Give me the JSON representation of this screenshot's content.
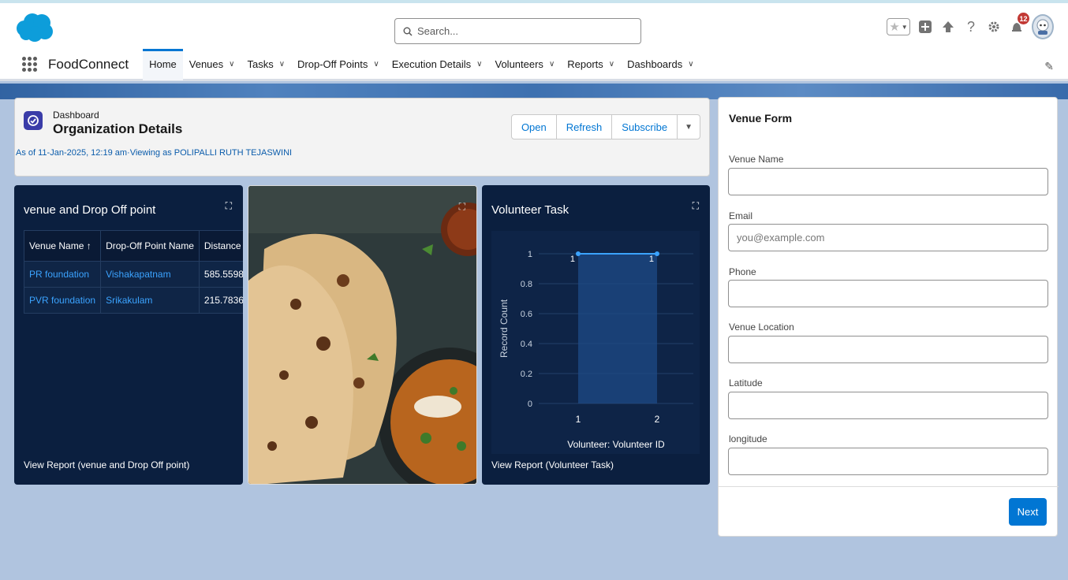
{
  "header": {
    "search_placeholder": "Search...",
    "notification_count": "12"
  },
  "nav": {
    "app_name": "FoodConnect",
    "tabs": [
      {
        "label": "Home",
        "active": true
      },
      {
        "label": "Venues"
      },
      {
        "label": "Tasks"
      },
      {
        "label": "Drop-Off Points"
      },
      {
        "label": "Execution Details"
      },
      {
        "label": "Volunteers"
      },
      {
        "label": "Reports"
      },
      {
        "label": "Dashboards"
      }
    ]
  },
  "dashboard": {
    "eyebrow": "Dashboard",
    "title": "Organization Details",
    "as_of": "As of 11-Jan-2025, 12:19 am·Viewing as POLIPALLI RUTH TEJASWINI",
    "buttons": {
      "open": "Open",
      "refresh": "Refresh",
      "subscribe": "Subscribe"
    }
  },
  "venue_card": {
    "title": "venue and Drop Off point",
    "columns": [
      "Venue Name ↑",
      "Drop-Off Point Name",
      "Distance"
    ],
    "rows": [
      [
        "PR foundation",
        "Vishakapatnam",
        "585.5598"
      ],
      [
        "PVR foundation",
        "Srikakulam",
        "215.7836"
      ]
    ],
    "footer": "View Report (venue and Drop Off point)"
  },
  "volunteer_card": {
    "title": "Volunteer Task",
    "footer": "View Report (Volunteer Task)"
  },
  "chart_data": {
    "type": "line",
    "title": "Volunteer Task",
    "xlabel": "Volunteer: Volunteer ID",
    "ylabel": "Record Count",
    "x": [
      "1",
      "2"
    ],
    "series": [
      {
        "values": [
          1,
          1
        ]
      }
    ],
    "data_labels": [
      "1",
      "1"
    ],
    "yticks": [
      "1",
      "0.8",
      "0.6",
      "0.4",
      "0.2",
      "0"
    ],
    "ylim": [
      0,
      1
    ],
    "grid": true,
    "colors": {
      "line": "#3ba3ff",
      "fill": "#1e4a86"
    }
  },
  "venue_form": {
    "title": "Venue Form",
    "fields": [
      {
        "label": "Venue Name",
        "placeholder": ""
      },
      {
        "label": "Email",
        "placeholder": "you@example.com"
      },
      {
        "label": "Phone",
        "placeholder": ""
      },
      {
        "label": "Venue Location",
        "placeholder": ""
      },
      {
        "label": "Latitude",
        "placeholder": ""
      },
      {
        "label": "longitude",
        "placeholder": ""
      }
    ],
    "next_label": "Next"
  },
  "colors": {
    "brand": "#0176d3",
    "card_bg": "#0b1f3f",
    "page_bg": "#b0c4df"
  }
}
